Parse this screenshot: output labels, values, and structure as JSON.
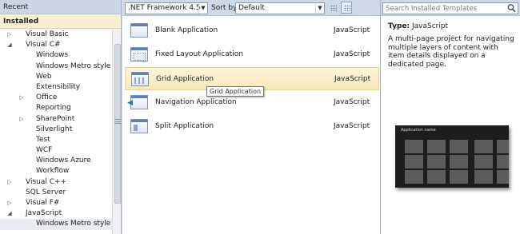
{
  "left": {
    "recent_label": "Recent",
    "installed_label": "Installed",
    "tree": [
      {
        "label": "Visual Basic",
        "indent": 1,
        "arrow": "collapsed"
      },
      {
        "label": "Visual C#",
        "indent": 1,
        "arrow": "expanded"
      },
      {
        "label": "Windows",
        "indent": 2,
        "arrow": "none"
      },
      {
        "label": "Windows Metro style",
        "indent": 2,
        "arrow": "none"
      },
      {
        "label": "Web",
        "indent": 2,
        "arrow": "none"
      },
      {
        "label": "Extensibility",
        "indent": 2,
        "arrow": "none"
      },
      {
        "label": "Office",
        "indent": 2,
        "arrow": "collapsed"
      },
      {
        "label": "Reporting",
        "indent": 2,
        "arrow": "none"
      },
      {
        "label": "SharePoint",
        "indent": 2,
        "arrow": "collapsed"
      },
      {
        "label": "Silverlight",
        "indent": 2,
        "arrow": "none"
      },
      {
        "label": "Test",
        "indent": 2,
        "arrow": "none"
      },
      {
        "label": "WCF",
        "indent": 2,
        "arrow": "none"
      },
      {
        "label": "Windows Azure",
        "indent": 2,
        "arrow": "none"
      },
      {
        "label": "Workflow",
        "indent": 2,
        "arrow": "none"
      },
      {
        "label": "Visual C++",
        "indent": 1,
        "arrow": "collapsed"
      },
      {
        "label": "SQL Server",
        "indent": 1,
        "arrow": "none"
      },
      {
        "label": "Visual F#",
        "indent": 1,
        "arrow": "collapsed"
      },
      {
        "label": "JavaScript",
        "indent": 1,
        "arrow": "expanded"
      },
      {
        "label": "Windows Metro style",
        "indent": 2,
        "arrow": "none",
        "selected": true
      }
    ]
  },
  "toolbar": {
    "framework_value": ".NET Framework 4.5",
    "sort_label": "Sort by:",
    "sort_value": "Default"
  },
  "templates": [
    {
      "name": "Blank Application",
      "language": "JavaScript",
      "icon": "blank"
    },
    {
      "name": "Fixed Layout Application",
      "language": "JavaScript",
      "icon": "fixed"
    },
    {
      "name": "Grid Application",
      "language": "JavaScript",
      "icon": "grid",
      "hover": true
    },
    {
      "name": "Navigation Application",
      "language": "JavaScript",
      "icon": "nav"
    },
    {
      "name": "Split Application",
      "language": "JavaScript",
      "icon": "split"
    }
  ],
  "tooltip": "Grid Application",
  "details": {
    "search_placeholder": "Search Installed Templates",
    "type_label": "Type:",
    "type_value": "JavaScript",
    "description": "A multi-page project for navigating multiple layers of content with item details displayed on a dedicated page.",
    "preview_title": "Application name"
  },
  "colors": {
    "installed_bg": "#f8eed0",
    "hover_bg": "#f8e8b8",
    "chrome_bg": "#cfd8e6"
  }
}
